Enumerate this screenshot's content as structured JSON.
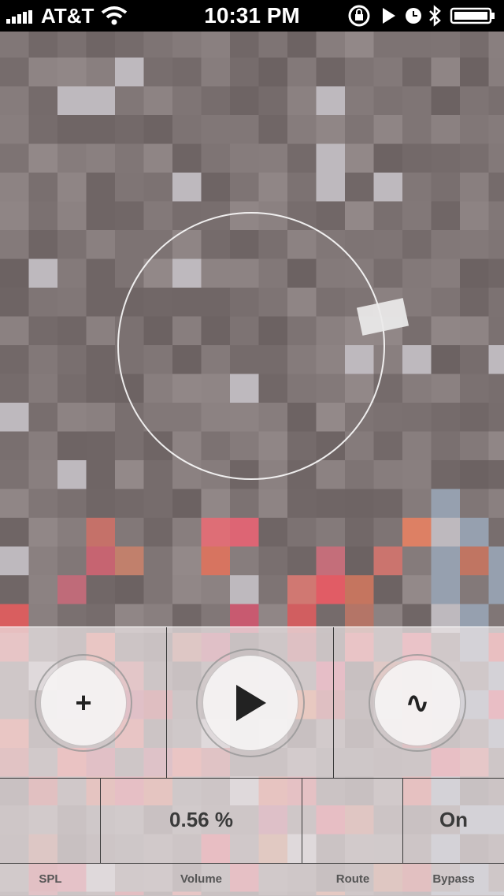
{
  "status_bar": {
    "carrier": "AT&T",
    "time": "10:31 PM"
  },
  "controls": {
    "add_button": {
      "symbol": "+",
      "icon": "plus-icon"
    },
    "play_button": {
      "icon": "play-icon"
    },
    "filter_button": {
      "symbol": "∿",
      "icon": "sine-wave-icon"
    }
  },
  "readouts": {
    "volume_value": "0.56 %",
    "bypass_value": "On"
  },
  "labels": {
    "spl": "SPL",
    "volume": "Volume",
    "route": "Route",
    "bypass": "Bypass"
  },
  "colors": {
    "status_bar_bg": "#000000",
    "panel_bg": "#ebe4e6"
  }
}
